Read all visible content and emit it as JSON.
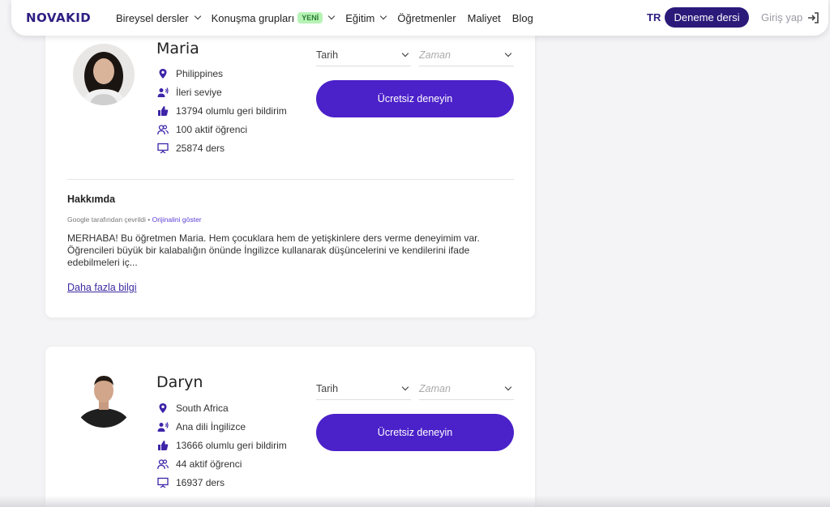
{
  "header": {
    "logo": "NOVAKID",
    "nav": [
      {
        "label": "Bireysel dersler",
        "dropdown": true
      },
      {
        "label": "Konuşma grupları",
        "badge": "YENİ",
        "dropdown": true
      },
      {
        "label": "Eğitim",
        "dropdown": true
      },
      {
        "label": "Öğretmenler",
        "dropdown": false
      },
      {
        "label": "Maliyet",
        "dropdown": false
      },
      {
        "label": "Blog",
        "dropdown": false
      }
    ],
    "lang": "TR",
    "trial_button": "Deneme dersi",
    "login": "Giriş yap"
  },
  "teachers": [
    {
      "name": "Maria",
      "country": "Philippines",
      "level": "İleri seviye",
      "feedback": "13794 olumlu geri bildirim",
      "students": "100 aktif öğrenci",
      "lessons": "25874 ders",
      "date_select": "Tarih",
      "time_select": "Zaman",
      "cta": "Ücretsiz deneyin",
      "about_title": "Hakkımda",
      "translated_by": "Google tarafından çevrildi",
      "show_original": "Orijinalini göster",
      "about_text": "MERHABA! Bu öğretmen Maria. Hem çocuklara hem de yetişkinlere ders verme deneyimim var. Öğrencileri büyük bir kalabalığın önünde İngilizce kullanarak düşüncelerini ve kendilerini ifade edebilmeleri iç...",
      "more": "Daha fazla bilgi"
    },
    {
      "name": "Daryn",
      "country": "South Africa",
      "level": "Ana dili İngilizce",
      "feedback": "13666 olumlu geri bildirim",
      "students": "44 aktif öğrenci",
      "lessons": "16937 ders",
      "date_select": "Tarih",
      "time_select": "Zaman",
      "cta": "Ücretsiz deneyin"
    }
  ],
  "colors": {
    "brand": "#2f2083",
    "cta": "#4b21c9",
    "badge_bg": "#b7f3b6"
  }
}
